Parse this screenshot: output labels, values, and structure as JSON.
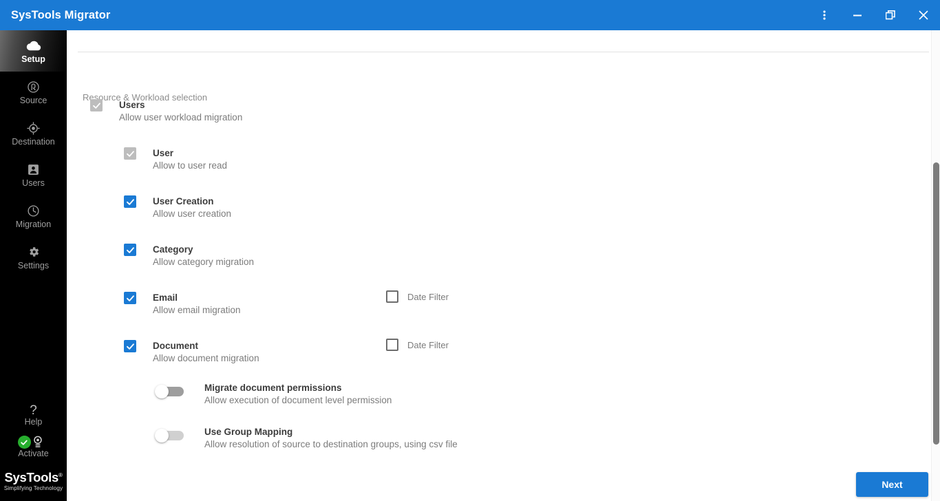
{
  "titlebar": {
    "app_title": "SysTools Migrator",
    "accent_color": "#1a7ad4",
    "controls": [
      {
        "name": "more-menu",
        "label": "⋮"
      },
      {
        "name": "minimize",
        "label": "–"
      },
      {
        "name": "restore",
        "label": "❐"
      },
      {
        "name": "close",
        "label": "✕"
      }
    ]
  },
  "sidebar": {
    "items": [
      {
        "label": "Setup",
        "icon": "cloud-icon",
        "active": true
      },
      {
        "label": "Source",
        "icon": "source-icon",
        "active": false
      },
      {
        "label": "Destination",
        "icon": "destination-icon",
        "active": false
      },
      {
        "label": "Users",
        "icon": "users-icon",
        "active": false
      },
      {
        "label": "Migration",
        "icon": "migration-clock-icon",
        "active": false
      },
      {
        "label": "Settings",
        "icon": "gear-icon",
        "active": false
      }
    ],
    "help": {
      "label": "Help",
      "glyph": "?"
    },
    "activate": {
      "label": "Activate",
      "badge": "check",
      "badge_color": "#27ae2e"
    },
    "logo": {
      "name": "SysTools",
      "mark": "®",
      "tagline": "Simplifying Technology"
    }
  },
  "main": {
    "section_caption": "Resource & Workload selection",
    "workloads": [
      {
        "title": "Users",
        "desc": "Allow user workload migration",
        "checkbox_state": "checked-disabled",
        "indent": "level1",
        "date_filter": null
      },
      {
        "title": "User",
        "desc": "Allow to user read",
        "checkbox_state": "checked-disabled",
        "indent": "level2",
        "date_filter": null
      },
      {
        "title": "User Creation",
        "desc": "Allow user creation",
        "checkbox_state": "checked",
        "indent": "level2",
        "date_filter": null
      },
      {
        "title": "Category",
        "desc": "Allow category migration",
        "checkbox_state": "checked",
        "indent": "level2",
        "date_filter": null
      },
      {
        "title": "Email",
        "desc": "Allow email migration",
        "checkbox_state": "checked",
        "indent": "level2",
        "date_filter": {
          "label": "Date Filter",
          "checked": false
        }
      },
      {
        "title": "Document",
        "desc": "Allow document migration",
        "checkbox_state": "checked",
        "indent": "level2",
        "date_filter": {
          "label": "Date Filter",
          "checked": false
        }
      }
    ],
    "toggles": [
      {
        "title": "Migrate document permissions",
        "desc": "Allow execution of document level permission",
        "state": "off",
        "style": "dark"
      },
      {
        "title": "Use Group Mapping",
        "desc": "Allow resolution of source to destination groups, using csv file",
        "state": "off",
        "style": "light"
      }
    ],
    "next_button": "Next"
  }
}
